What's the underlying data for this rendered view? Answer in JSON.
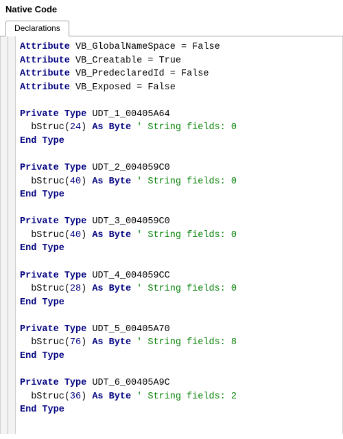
{
  "panel": {
    "title": "Native Code"
  },
  "tabs": {
    "active": "Declarations"
  },
  "code": {
    "attributes": [
      {
        "name": "VB_GlobalNameSpace",
        "value": "False"
      },
      {
        "name": "VB_Creatable",
        "value": "True"
      },
      {
        "name": "VB_PredeclaredId",
        "value": "False"
      },
      {
        "name": "VB_Exposed",
        "value": "False"
      }
    ],
    "types": [
      {
        "type_name": "UDT_1_00405A64",
        "field_name": "bStruc",
        "size": "24",
        "string_fields": "0"
      },
      {
        "type_name": "UDT_2_004059C0",
        "field_name": "bStruc",
        "size": "40",
        "string_fields": "0"
      },
      {
        "type_name": "UDT_3_004059C0",
        "field_name": "bStruc",
        "size": "40",
        "string_fields": "0"
      },
      {
        "type_name": "UDT_4_004059CC",
        "field_name": "bStruc",
        "size": "28",
        "string_fields": "0"
      },
      {
        "type_name": "UDT_5_00405A70",
        "field_name": "bStruc",
        "size": "76",
        "string_fields": "8"
      },
      {
        "type_name": "UDT_6_00405A9C",
        "field_name": "bStruc",
        "size": "36",
        "string_fields": "2"
      }
    ],
    "kw": {
      "attribute": "Attribute",
      "private": "Private",
      "type": "Type",
      "as": "As",
      "byte": "Byte",
      "end_type": "End Type"
    },
    "comment_prefix": "' String fields: "
  }
}
